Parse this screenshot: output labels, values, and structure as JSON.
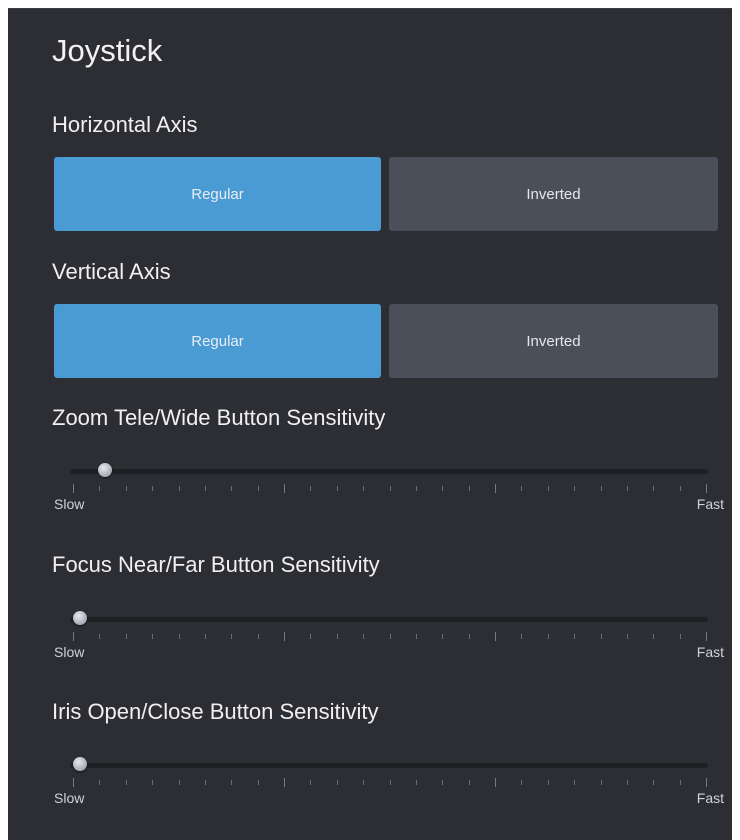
{
  "panel": {
    "title": "Joystick"
  },
  "horizontal_axis": {
    "label": "Horizontal Axis",
    "options": [
      "Regular",
      "Inverted"
    ],
    "selected": "Regular"
  },
  "vertical_axis": {
    "label": "Vertical Axis",
    "options": [
      "Regular",
      "Inverted"
    ],
    "selected": "Regular"
  },
  "zoom_sensitivity": {
    "label": "Zoom Tele/Wide Button Sensitivity",
    "min_label": "Slow",
    "max_label": "Fast",
    "value_fraction": 0.04,
    "tick_count": 25
  },
  "focus_sensitivity": {
    "label": "Focus Near/Far Button Sensitivity",
    "min_label": "Slow",
    "max_label": "Fast",
    "value_fraction": 0.0,
    "tick_count": 25
  },
  "iris_sensitivity": {
    "label": "Iris Open/Close Button Sensitivity",
    "min_label": "Slow",
    "max_label": "Fast",
    "value_fraction": 0.0,
    "tick_count": 25
  },
  "colors": {
    "panel_bg": "#2d2e33",
    "active_button": "#4a9ad4",
    "inactive_button": "#4a4f5a",
    "slider_track": "#1f2024"
  }
}
